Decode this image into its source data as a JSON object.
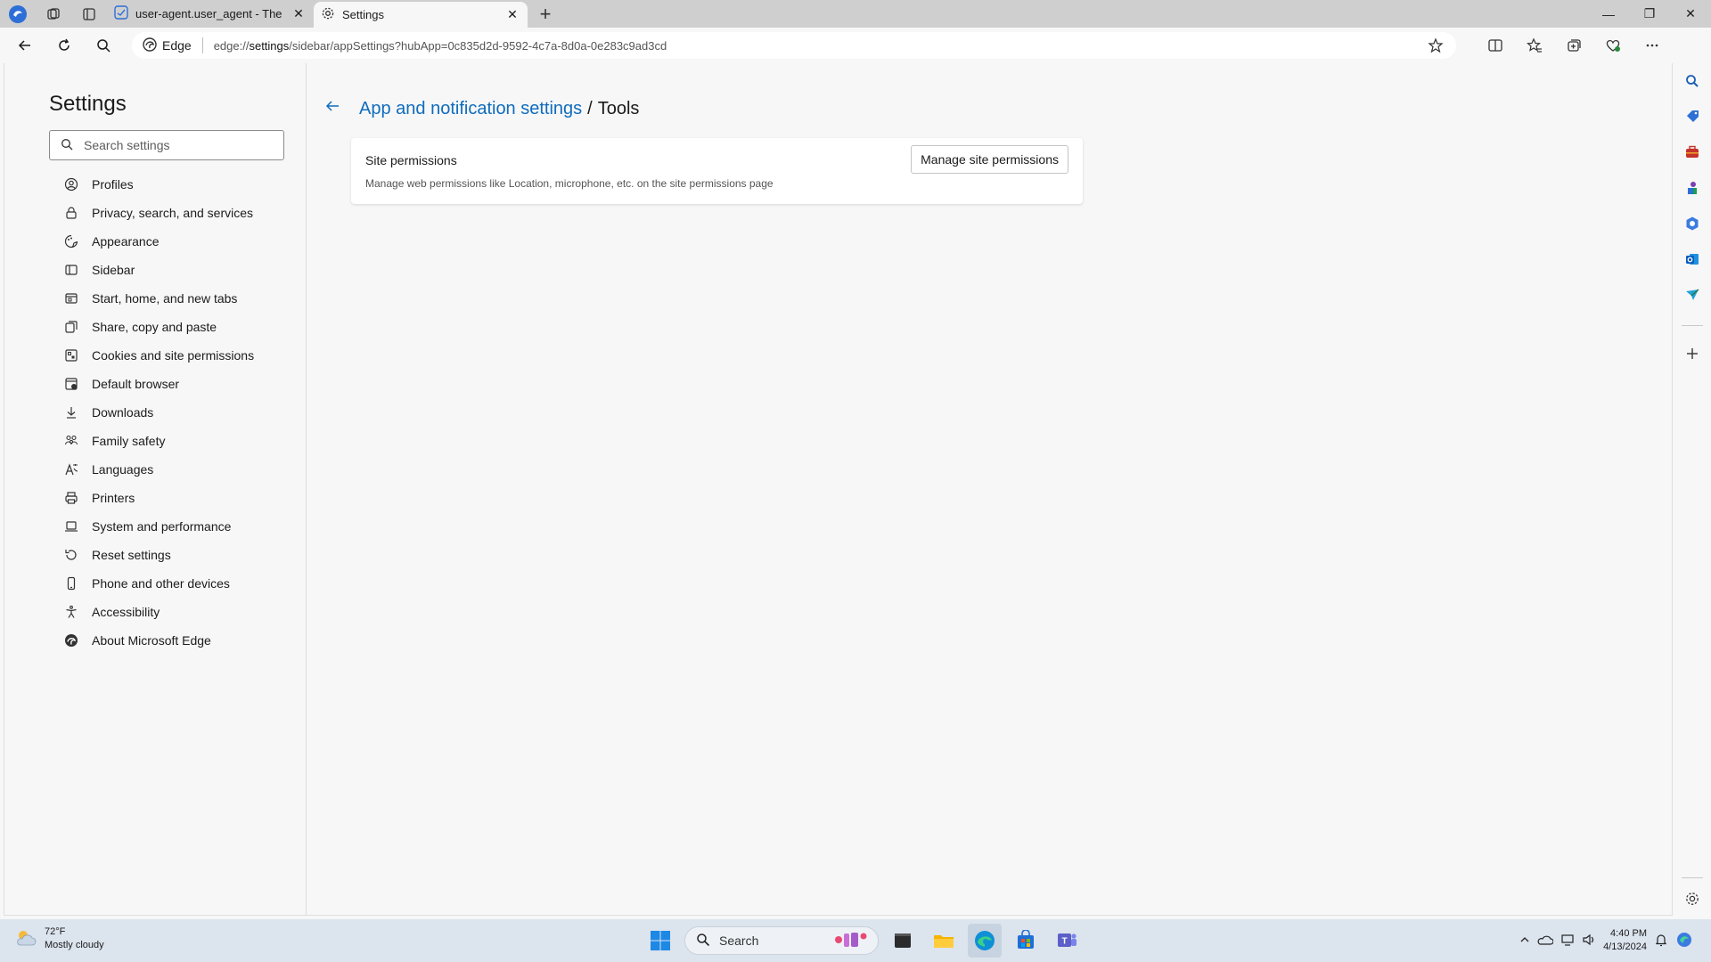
{
  "tabs": [
    {
      "title": "user-agent.user_agent - The Coll",
      "active": false
    },
    {
      "title": "Settings",
      "active": true
    }
  ],
  "address": {
    "site_label": "Edge",
    "url_prefix": "edge://",
    "url_host": "settings",
    "url_path": "/sidebar/appSettings?hubApp=0c835d2d-9592-4c7a-8d0a-0e283c9ad3cd"
  },
  "settings": {
    "title": "Settings",
    "search_placeholder": "Search settings",
    "nav": [
      {
        "label": "Profiles",
        "icon": "profile-icon"
      },
      {
        "label": "Privacy, search, and services",
        "icon": "lock-icon"
      },
      {
        "label": "Appearance",
        "icon": "appearance-icon"
      },
      {
        "label": "Sidebar",
        "icon": "sidebar-icon"
      },
      {
        "label": "Start, home, and new tabs",
        "icon": "home-icon"
      },
      {
        "label": "Share, copy and paste",
        "icon": "share-icon"
      },
      {
        "label": "Cookies and site permissions",
        "icon": "cookie-icon"
      },
      {
        "label": "Default browser",
        "icon": "browser-icon"
      },
      {
        "label": "Downloads",
        "icon": "download-icon"
      },
      {
        "label": "Family safety",
        "icon": "family-icon"
      },
      {
        "label": "Languages",
        "icon": "language-icon"
      },
      {
        "label": "Printers",
        "icon": "printer-icon"
      },
      {
        "label": "System and performance",
        "icon": "laptop-icon"
      },
      {
        "label": "Reset settings",
        "icon": "reset-icon"
      },
      {
        "label": "Phone and other devices",
        "icon": "phone-icon"
      },
      {
        "label": "Accessibility",
        "icon": "accessibility-icon"
      },
      {
        "label": "About Microsoft Edge",
        "icon": "edge-logo-icon"
      }
    ]
  },
  "content": {
    "breadcrumb_parent": "App and notification settings",
    "breadcrumb_separator": "/",
    "breadcrumb_current": "Tools",
    "card": {
      "title": "Site permissions",
      "description": "Manage web permissions like Location, microphone, etc. on the site permissions page",
      "button": "Manage site permissions"
    }
  },
  "taskbar": {
    "temperature": "72°F",
    "condition": "Mostly cloudy",
    "search_label": "Search",
    "time": "4:40 PM",
    "date": "4/13/2024"
  },
  "colors": {
    "accent": "#0f6cbd",
    "page_bg": "#f7f7f7",
    "tabbar_bg": "#cfcfcf",
    "taskbar_bg": "#dce4ee"
  }
}
